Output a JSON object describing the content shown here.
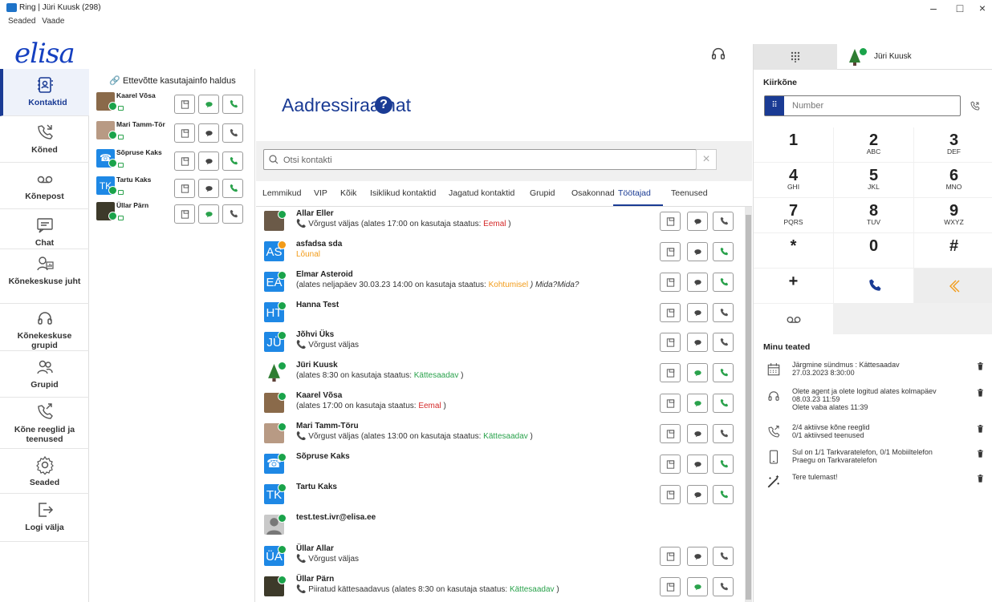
{
  "window": {
    "title": "Ring | Jüri Kuusk (298)",
    "menu": [
      "Seaded",
      "Vaade"
    ],
    "controls": [
      "–",
      "□",
      "×"
    ]
  },
  "brand": {
    "logo_text": "elisa"
  },
  "sidebar": {
    "items": [
      {
        "label": "Kontaktid",
        "icon": "contacts-icon",
        "active": true
      },
      {
        "label": "Kõned",
        "icon": "call-history-icon"
      },
      {
        "label": "Kõnepost",
        "icon": "voicemail-icon"
      },
      {
        "label": "Chat",
        "icon": "chat-icon"
      },
      {
        "label": "Kõnekeskuse juht",
        "icon": "callcenter-manager-icon"
      },
      {
        "label": "Kõnekeskuse grupid",
        "icon": "headset-icon"
      },
      {
        "label": "Grupid",
        "icon": "groups-icon"
      },
      {
        "label": "Kõne reeglid ja teenused",
        "icon": "call-rules-icon"
      },
      {
        "label": "Seaded",
        "icon": "gear-icon"
      },
      {
        "label": "Logi välja",
        "icon": "logout-icon"
      }
    ]
  },
  "favorites": {
    "header": "Ettevõtte kasutajainfo haldus",
    "items": [
      {
        "name": "Kaarel Võsa",
        "avatar": "photo-goat",
        "chat_active": true,
        "call_active": true
      },
      {
        "name": "Mari Tamm-Tör",
        "avatar": "photo-baby",
        "chat_active": false,
        "call_active": false
      },
      {
        "name": "Sõpruse Kaks",
        "avatar": "phone-icon",
        "chat_active": false,
        "call_active": true
      },
      {
        "name": "Tartu Kaks",
        "initials": "TK",
        "chat_active": false,
        "call_active": true
      },
      {
        "name": "Üllar Pärn",
        "avatar": "photo-animal",
        "chat_active": true,
        "call_active": false
      }
    ]
  },
  "main": {
    "title": "Aadressiraamat",
    "help": "?",
    "search_placeholder": "Otsi kontakti",
    "tabs": [
      "Lemmikud",
      "VIP",
      "Kõik",
      "Isiklikud kontaktid",
      "Jagatud kontaktid",
      "Grupid",
      "Osakonnad",
      "Töötajad",
      "Teenused"
    ],
    "active_tab": "Töötajad",
    "contacts": [
      {
        "name": "Allar Eller",
        "avatar": "photo-dog",
        "status": [
          "📞 Võrgust väljas ",
          "(alates 17:00 on kasutaja staatus: ",
          "Eemal",
          " )"
        ]
      },
      {
        "name": "asfadsa sda",
        "initials": "AS",
        "badge": "orange",
        "status_single": "Lõunal"
      },
      {
        "name": "Elmar Asteroid",
        "initials": "EA",
        "status": [
          "",
          "(alates neljapäev 30.03.23 14:00 on kasutaja staatus: ",
          "Kohtumisel",
          " ) Mida?Mida?"
        ]
      },
      {
        "name": "Hanna Test",
        "initials": "HT",
        "status": [
          "",
          "",
          "",
          ""
        ]
      },
      {
        "name": "Jõhvi Üks",
        "initials": "JÜ",
        "status": [
          "📞 Võrgust väljas ",
          "",
          "",
          ""
        ]
      },
      {
        "name": "Jüri Kuusk",
        "avatar": "photo-tree",
        "status": [
          "",
          "(alates 8:30 on kasutaja staatus: ",
          "Kättesaadav",
          " )"
        ]
      },
      {
        "name": "Kaarel Võsa",
        "avatar": "photo-goat",
        "status": [
          "",
          "(alates 17:00 on kasutaja staatus: ",
          "Eemal",
          " )"
        ]
      },
      {
        "name": "Mari Tamm-Töru",
        "avatar": "photo-baby",
        "status": [
          "📞 Võrgust väljas ",
          "(alates 13:00 on kasutaja staatus: ",
          "Kättesaadav",
          " )"
        ]
      },
      {
        "name": "Sõpruse Kaks",
        "avatar": "phone-icon",
        "status": [
          "",
          "",
          "",
          ""
        ]
      },
      {
        "name": "Tartu Kaks",
        "initials": "TK",
        "status": [
          "",
          "",
          "",
          ""
        ]
      },
      {
        "name": "test.test.ivr@elisa.ee",
        "avatar": "person-placeholder",
        "status": [
          "",
          "",
          "",
          ""
        ]
      },
      {
        "name": "Üllar Allar",
        "initials": "ÜA",
        "status": [
          "📞 Võrgust väljas ",
          "",
          "",
          ""
        ]
      },
      {
        "name": "Üllar Pärn",
        "avatar": "photo-animal",
        "status": [
          "📞 Piiratud kättesaadavus ",
          "(alates 8:30 on kasutaja staatus: ",
          "Kättesaadav",
          " )"
        ]
      }
    ]
  },
  "right": {
    "user": "Jüri Kuusk",
    "quick_call": "Kiirkõne",
    "number_placeholder": "Number",
    "keys": [
      {
        "d": "1",
        "l": ""
      },
      {
        "d": "2",
        "l": "ABC"
      },
      {
        "d": "3",
        "l": "DEF"
      },
      {
        "d": "4",
        "l": "GHI"
      },
      {
        "d": "5",
        "l": "JKL"
      },
      {
        "d": "6",
        "l": "MNO"
      },
      {
        "d": "7",
        "l": "PQRS"
      },
      {
        "d": "8",
        "l": "TUV"
      },
      {
        "d": "9",
        "l": "WXYZ"
      },
      {
        "d": "*",
        "l": ""
      },
      {
        "d": "0",
        "l": ""
      },
      {
        "d": "#",
        "l": ""
      },
      {
        "d": "+",
        "l": ""
      }
    ],
    "notifications_title": "Minu teated",
    "notifications": [
      {
        "icon": "calendar-icon",
        "lines": [
          "Järgmine sündmus : Kättesaadav",
          "27.03.2023 8:30:00"
        ]
      },
      {
        "icon": "headset-icon",
        "lines": [
          "Olete agent ja olete logitud alates kolmapäev",
          "08.03.23 11:59",
          "Olete vaba alates 11:39"
        ]
      },
      {
        "icon": "call-rules-icon",
        "lines": [
          "2/4 aktiivse kõne reeglid",
          "0/1 aktiivsed teenused"
        ]
      },
      {
        "icon": "mobile-icon",
        "lines": [
          "Sul on 1/1 Tarkvaratelefon, 0/1 Mobiiltelefon",
          "Praegu on Tarkvaratelefon"
        ]
      },
      {
        "icon": "magic-wand-icon",
        "lines": [
          "Tere tulemast!"
        ]
      }
    ]
  },
  "colors": {
    "brand": "#1a3b94",
    "green": "#2aa24c",
    "red": "#d42727",
    "orange": "#f29b18",
    "avatar_blue": "#1e88e5"
  }
}
